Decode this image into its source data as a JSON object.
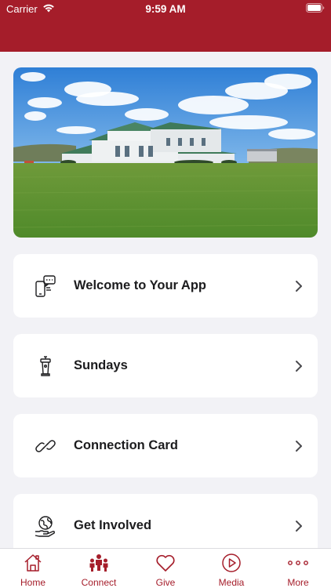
{
  "status_bar": {
    "carrier": "Carrier",
    "time": "9:59 AM"
  },
  "hero": {
    "image": "church-building-photo"
  },
  "menu": [
    {
      "label": "Welcome to Your App",
      "icon": "phone-chat-icon"
    },
    {
      "label": "Sundays",
      "icon": "podium-icon"
    },
    {
      "label": "Connection Card",
      "icon": "link-icon"
    },
    {
      "label": "Get Involved",
      "icon": "globe-hand-icon"
    }
  ],
  "tabbar": {
    "tabs": [
      {
        "label": "Home",
        "icon": "home-icon"
      },
      {
        "label": "Connect",
        "icon": "people-icon"
      },
      {
        "label": "Give",
        "icon": "heart-icon"
      },
      {
        "label": "Media",
        "icon": "play-icon"
      },
      {
        "label": "More",
        "icon": "more-dots-icon"
      }
    ]
  },
  "colors": {
    "brand": "#a51d2a",
    "background": "#f2f2f6",
    "card": "#ffffff",
    "text": "#1c1c1e"
  }
}
